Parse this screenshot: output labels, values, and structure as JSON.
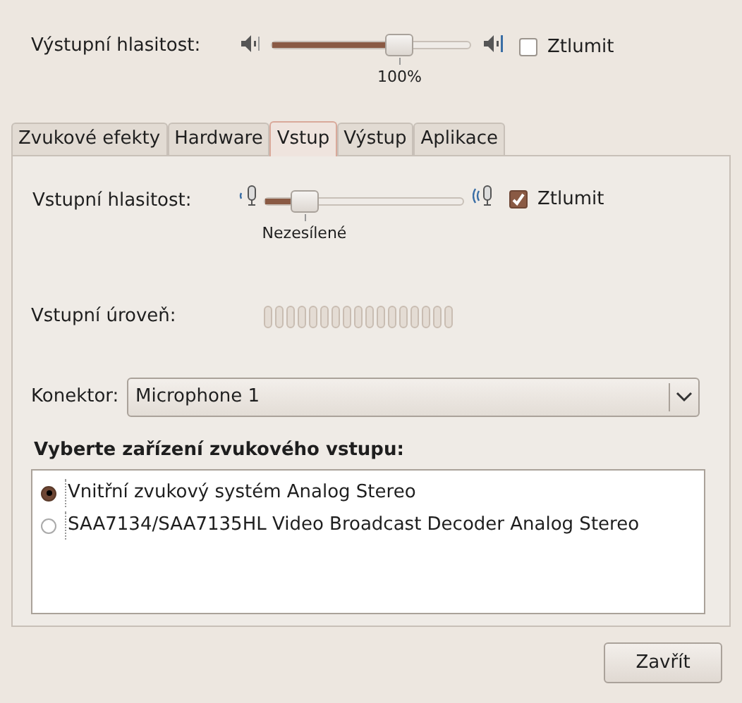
{
  "output_volume": {
    "label": "Výstupní hlasitost:",
    "level": 0.65,
    "mark": "100%",
    "mute": {
      "label": "Ztlumit",
      "checked": false
    }
  },
  "tabs": [
    {
      "label": "Zvukové efekty",
      "selected": false
    },
    {
      "label": "Hardware",
      "selected": false
    },
    {
      "label": "Vstup",
      "selected": true
    },
    {
      "label": "Výstup",
      "selected": false
    },
    {
      "label": "Aplikace",
      "selected": false
    }
  ],
  "input_volume": {
    "label": "Vstupní hlasitost:",
    "level": 0.15,
    "mark": "Nezesílené",
    "mute": {
      "label": "Ztlumit",
      "checked": true
    }
  },
  "input_level": {
    "label": "Vstupní úroveň:"
  },
  "connector": {
    "label": "Konektor:",
    "value": "Microphone 1"
  },
  "devices": {
    "heading": "Vyberte zařízení zvukového vstupu:",
    "items": [
      {
        "label": "Vnitřní zvukový systém Analog Stereo",
        "selected": true
      },
      {
        "label": "SAA7134/SAA7135HL Video Broadcast Decoder Analog Stereo",
        "selected": false
      }
    ]
  },
  "close_button": "Zavřít"
}
